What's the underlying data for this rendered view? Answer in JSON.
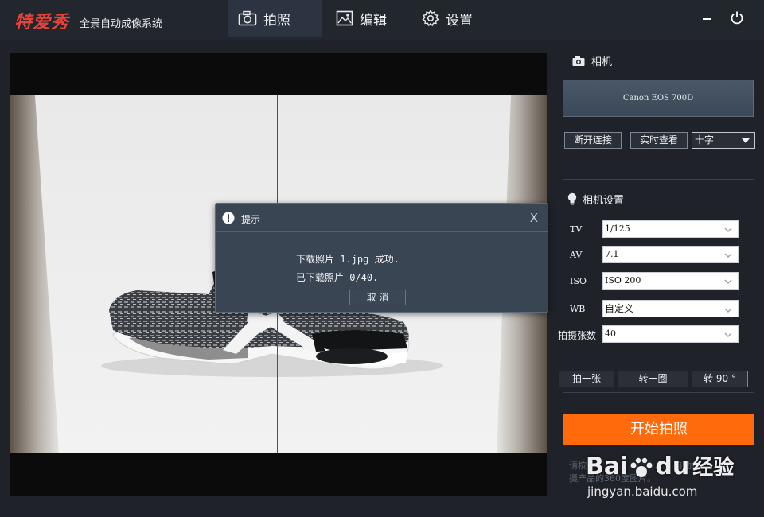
{
  "app": {
    "logo": "特爱秀",
    "subtitle": "全景自动成像系统",
    "accent": "#ff6a0d",
    "logo_color": "#e8433a"
  },
  "tabs": [
    {
      "label": "拍照",
      "icon": "camera-icon",
      "active": true
    },
    {
      "label": "编辑",
      "icon": "image-edit-icon",
      "active": false
    },
    {
      "label": "设置",
      "icon": "gear-icon",
      "active": false
    }
  ],
  "window_controls": {
    "minimize": "minimize-icon",
    "power": "power-icon"
  },
  "dialog": {
    "title": "提示",
    "close": "X",
    "line1": "下载照片 1.jpg 成功.",
    "line2": "已下载照片 0/40.",
    "cancel": "取 消"
  },
  "camera": {
    "section_title": "相机",
    "model": "Canon EOS 700D",
    "disconnect": "断开连接",
    "live_view": "实时查看",
    "overlay": "十字"
  },
  "settings": {
    "section_title": "相机设置",
    "tv_label": "TV",
    "tv_value": "1/125",
    "av_label": "AV",
    "av_value": "7.1",
    "iso_label": "ISO",
    "iso_value": "ISO 200",
    "wb_label": "WB",
    "wb_value": "自定义",
    "count_label": "拍摄张数",
    "count_value": "40"
  },
  "actions": {
    "shoot_one": "拍一张",
    "rotate_full": "转一圈",
    "rotate_90": "转 90 °",
    "start": "开始拍照"
  },
  "hint": {
    "line1": "请按…………………………自动拍",
    "line2": "摄产品的360度图片。"
  },
  "watermark": {
    "brand": "Bai",
    "brand2": "du",
    "cn": "经验",
    "url": "jingyan.baidu.com"
  }
}
